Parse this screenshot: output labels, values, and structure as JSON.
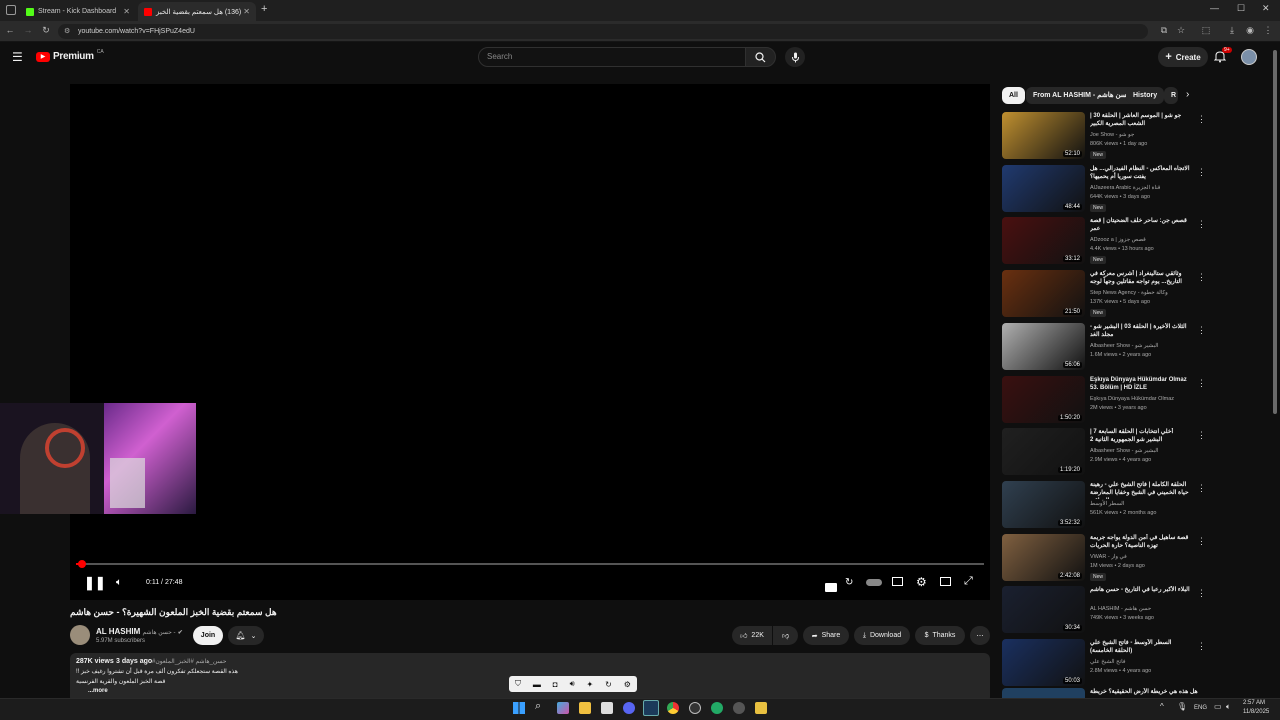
{
  "browser": {
    "tabs": [
      {
        "title": "Stream - Kick Dashboard",
        "favicon_color": "#53fc18"
      },
      {
        "title": "(136) هل سمعتم بقضية الخبز",
        "favicon_color": "#ff0000"
      }
    ],
    "new_tab": "+",
    "url": "youtube.com/watch?v=FHjSPuZ4edU"
  },
  "header": {
    "logo_text": "Premium",
    "region": "CA",
    "search_placeholder": "Search",
    "create_label": "Create",
    "notif_count": "9+"
  },
  "player": {
    "time": "0:11 / 27:48",
    "progress_fraction": 0.0066
  },
  "video": {
    "title": "هل سمعتم بقضية الخبز الملعون الشهيرة؟ - حسن هاشم",
    "channel": "AL HASHIM",
    "channel_arabic": "حسن هاشم -",
    "subscribers": "5.97M subscribers",
    "join_label": "Join",
    "likes": "22K",
    "share_label": "Share",
    "download_label": "Download",
    "thanks_label": "Thanks",
    "views": "287K views",
    "age": "3 days ago",
    "hashtags": "#حسن_هاشم #الخبز_الملعون",
    "desc_line1": "هذه القصة ستجعلكم تفكرون ألف مرة قبل أن تشتروا رغيف خبز !!",
    "desc_line2": "قصة الخبز الملعون والقرية الفرنسية",
    "more_label": "...more"
  },
  "sidebar": {
    "chips": [
      "All",
      "From AL HASHIM - حسن هاشم",
      "History",
      "R"
    ],
    "recommendations": [
      {
        "title": "جو شو | الموسم العاشر | الحلقة 30 | الشعب المصرية الكبير",
        "channel": "Joe Show - جو شو",
        "meta": "806K views • 1 day ago",
        "duration": "52:10",
        "new": "New",
        "color": "#c09030"
      },
      {
        "title": "الاتجاه المعاكس - النظام الفيدرالي... هل يفتت سوريا أم يحميها؟",
        "channel": "AlJazeera Arabic قناة الجزيرة",
        "meta": "644K views • 3 days ago",
        "duration": "48:44",
        "new": "New",
        "color": "#203a70"
      },
      {
        "title": "قصص جن: ساحر خلف الضحيتان | قصة عمر",
        "channel": "ADzooz a | قصص جزوز",
        "meta": "4.4K views • 13 hours ago",
        "duration": "33:12",
        "new": "New",
        "color": "#4a1010"
      },
      {
        "title": "وثائقي ستالينغراد | أشرس معركة في التاريخ... يوم تواجه مقاتلين وجهاً لوجه",
        "channel": "Step News Agency - وكالة خطوة",
        "meta": "137K views • 5 days ago",
        "duration": "21:50",
        "new": "New",
        "color": "#6a3010"
      },
      {
        "title": "الثلاث الأخيرة | الحلقة 03 | البشير شو - مجلد الغد",
        "channel": "Albasheer Show - البشير شو",
        "meta": "1.6M views • 2 years ago",
        "duration": "56:06",
        "new": "",
        "color": "#b0b0b0"
      },
      {
        "title": "Eşkıya Dünyaya Hükümdar Olmaz 53. Bölüm | HD İZLE",
        "channel": "Eşkıya Dünyaya Hükümdar Olmaz",
        "meta": "2M views • 3 years ago",
        "duration": "1:50:20",
        "new": "",
        "color": "#3a1010"
      },
      {
        "title": "أخلي انتخابات | الحلقة السابعة 7 | البشير شو الجمهورية الثانية 2",
        "channel": "Albasheer Show - البشير شو",
        "meta": "2.9M views • 4 years ago",
        "duration": "1:19:20",
        "new": "",
        "color": "#202020"
      },
      {
        "title": "الحلقة الكاملة | فاتح الشيخ علي - رهينة حياة الخميني في الشيخ وخفايا المعارضة العراقية",
        "channel": "السطر الأوسط",
        "meta": "561K views • 2 months ago",
        "duration": "3:52:32",
        "new": "",
        "color": "#304050"
      },
      {
        "title": "قصة ساهيل في أمن الدولة يواجه جريمة تهزه الناصية؟ حارة الحريات",
        "channel": "VWAR - في وار",
        "meta": "1M views • 2 days ago",
        "duration": "2:42:08",
        "new": "New",
        "color": "#806040"
      },
      {
        "title": "البلاء الأكبر رعباً في التاريخ - حسن هاشم",
        "channel": "AL HASHIM - حسن هاشم",
        "meta": "749K views • 3 weeks ago",
        "duration": "30:34",
        "new": "",
        "color": "#1a2030"
      },
      {
        "title": "السطر الأوسط - فاتح الشيخ علي (الحلقة الخامسة)",
        "channel": "فاتح الشيخ علي",
        "meta": "2.8M views • 4 years ago",
        "duration": "50:03",
        "new": "",
        "color": "#1a3060"
      }
    ],
    "partial_title": "هل هذه هي خريطة الأرض الحقيقية؟ خريطة"
  },
  "taskbar": {
    "lang": "ENG",
    "time": "2:57 AM",
    "date": "11/8/2025"
  }
}
